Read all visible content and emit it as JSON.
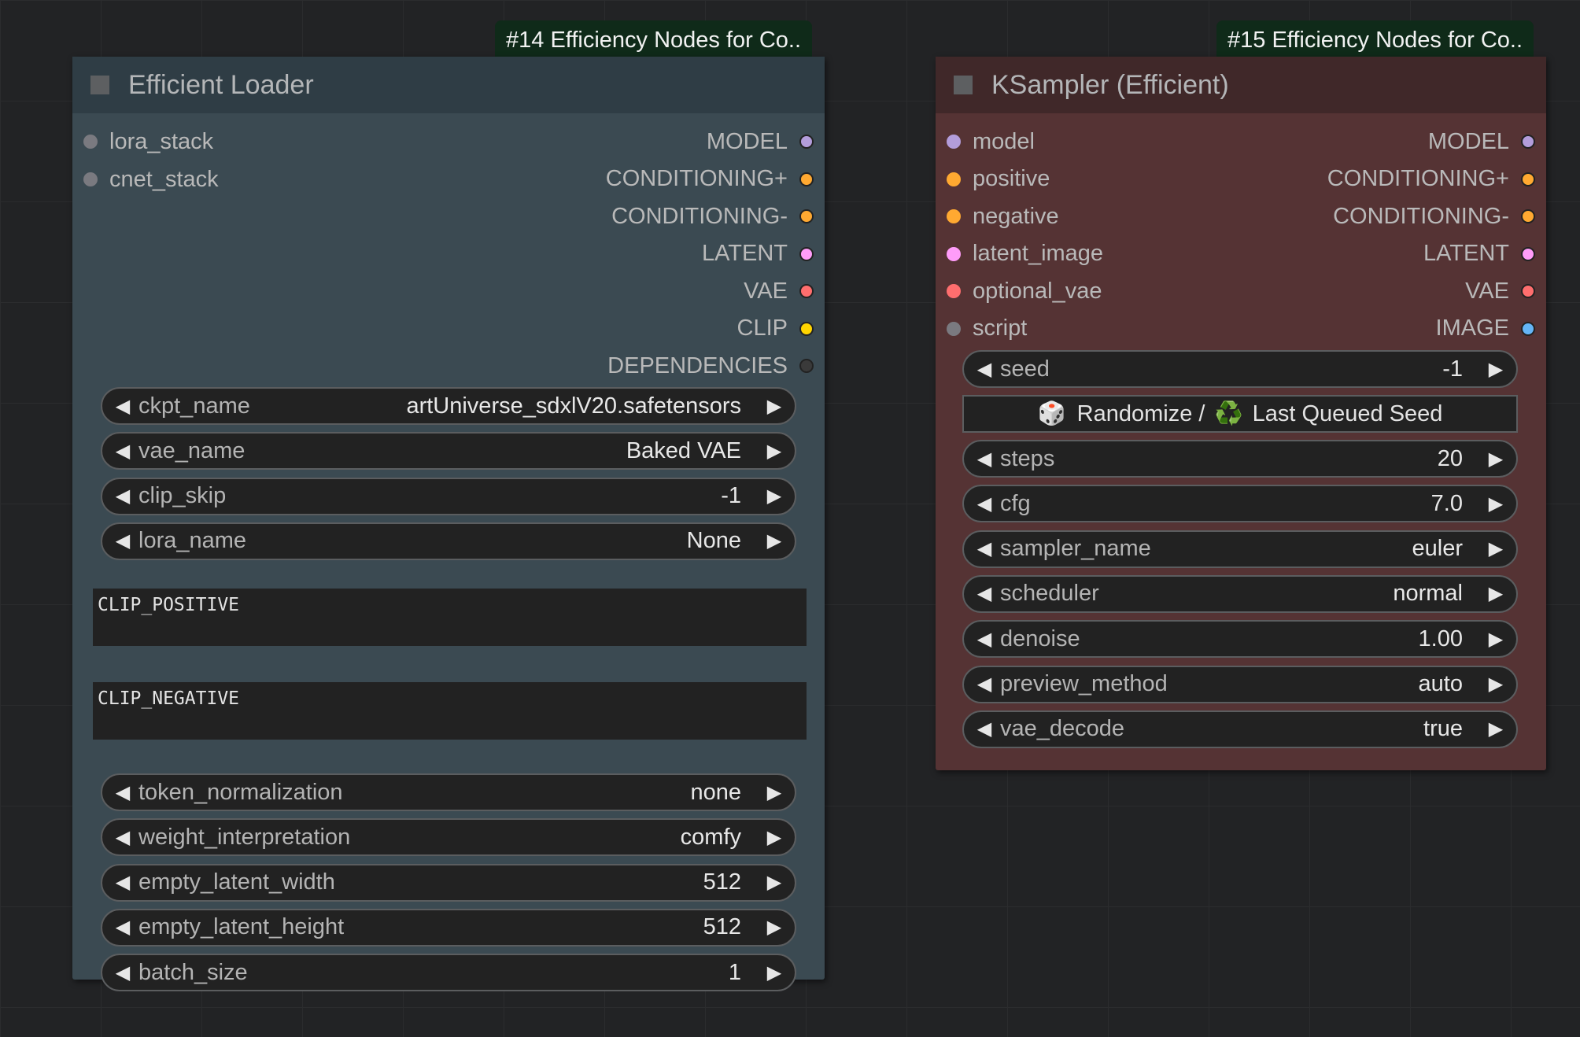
{
  "colors": {
    "canvas": "#222325",
    "loader_body": "#3b4a52",
    "loader_title": "#2f3d45",
    "ksampler_body": "#553334",
    "ksampler_title": "#402829",
    "badge_bg": "#0f2a19",
    "slot_model": "#b39ddb",
    "slot_conditioning": "#ffa931",
    "slot_latent": "#ff9cf9",
    "slot_vae": "#ff6e6e",
    "slot_clip": "#ffd500",
    "slot_image": "#64b5f6",
    "slot_generic": "#7a7a80",
    "slot_dependencies": "#3a3a3a"
  },
  "loader": {
    "badge": "#14 Efficiency Nodes for Co..",
    "title": "Efficient Loader",
    "inputs": [
      {
        "label": "lora_stack",
        "color": "#7a7a80"
      },
      {
        "label": "cnet_stack",
        "color": "#7a7a80"
      }
    ],
    "outputs": [
      {
        "label": "MODEL",
        "color": "#b39ddb"
      },
      {
        "label": "CONDITIONING+",
        "color": "#ffa931"
      },
      {
        "label": "CONDITIONING-",
        "color": "#ffa931"
      },
      {
        "label": "LATENT",
        "color": "#ff9cf9"
      },
      {
        "label": "VAE",
        "color": "#ff6e6e"
      },
      {
        "label": "CLIP",
        "color": "#ffd500"
      },
      {
        "label": "DEPENDENCIES",
        "color": "#3a3a3a"
      }
    ],
    "widgets_top": [
      {
        "label": "ckpt_name",
        "value": "artUniverse_sdxlV20.safetensors"
      },
      {
        "label": "vae_name",
        "value": "Baked VAE"
      },
      {
        "label": "clip_skip",
        "value": "-1"
      },
      {
        "label": "lora_name",
        "value": "None"
      }
    ],
    "clip_positive": "CLIP_POSITIVE",
    "clip_negative": "CLIP_NEGATIVE",
    "widgets_bottom": [
      {
        "label": "token_normalization",
        "value": "none"
      },
      {
        "label": "weight_interpretation",
        "value": "comfy"
      },
      {
        "label": "empty_latent_width",
        "value": "512"
      },
      {
        "label": "empty_latent_height",
        "value": "512"
      },
      {
        "label": "batch_size",
        "value": "1"
      }
    ]
  },
  "ksampler": {
    "badge": "#15 Efficiency Nodes for Co..",
    "title": "KSampler (Efficient)",
    "inputs": [
      {
        "label": "model",
        "color": "#b39ddb"
      },
      {
        "label": "positive",
        "color": "#ffa931"
      },
      {
        "label": "negative",
        "color": "#ffa931"
      },
      {
        "label": "latent_image",
        "color": "#ff9cf9"
      },
      {
        "label": "optional_vae",
        "color": "#ff6e6e"
      },
      {
        "label": "script",
        "color": "#7a7a80"
      }
    ],
    "outputs": [
      {
        "label": "MODEL",
        "color": "#b39ddb"
      },
      {
        "label": "CONDITIONING+",
        "color": "#ffa931"
      },
      {
        "label": "CONDITIONING-",
        "color": "#ffa931"
      },
      {
        "label": "LATENT",
        "color": "#ff9cf9"
      },
      {
        "label": "VAE",
        "color": "#ff6e6e"
      },
      {
        "label": "IMAGE",
        "color": "#64b5f6"
      }
    ],
    "seed": {
      "label": "seed",
      "value": "-1"
    },
    "seed_button": {
      "dice_icon": "🎲",
      "text1": "Randomize /",
      "recycle_icon": "♻️",
      "text2": "Last Queued Seed"
    },
    "widgets": [
      {
        "label": "steps",
        "value": "20"
      },
      {
        "label": "cfg",
        "value": "7.0"
      },
      {
        "label": "sampler_name",
        "value": "euler"
      },
      {
        "label": "scheduler",
        "value": "normal"
      },
      {
        "label": "denoise",
        "value": "1.00"
      },
      {
        "label": "preview_method",
        "value": "auto"
      },
      {
        "label": "vae_decode",
        "value": "true"
      }
    ]
  }
}
